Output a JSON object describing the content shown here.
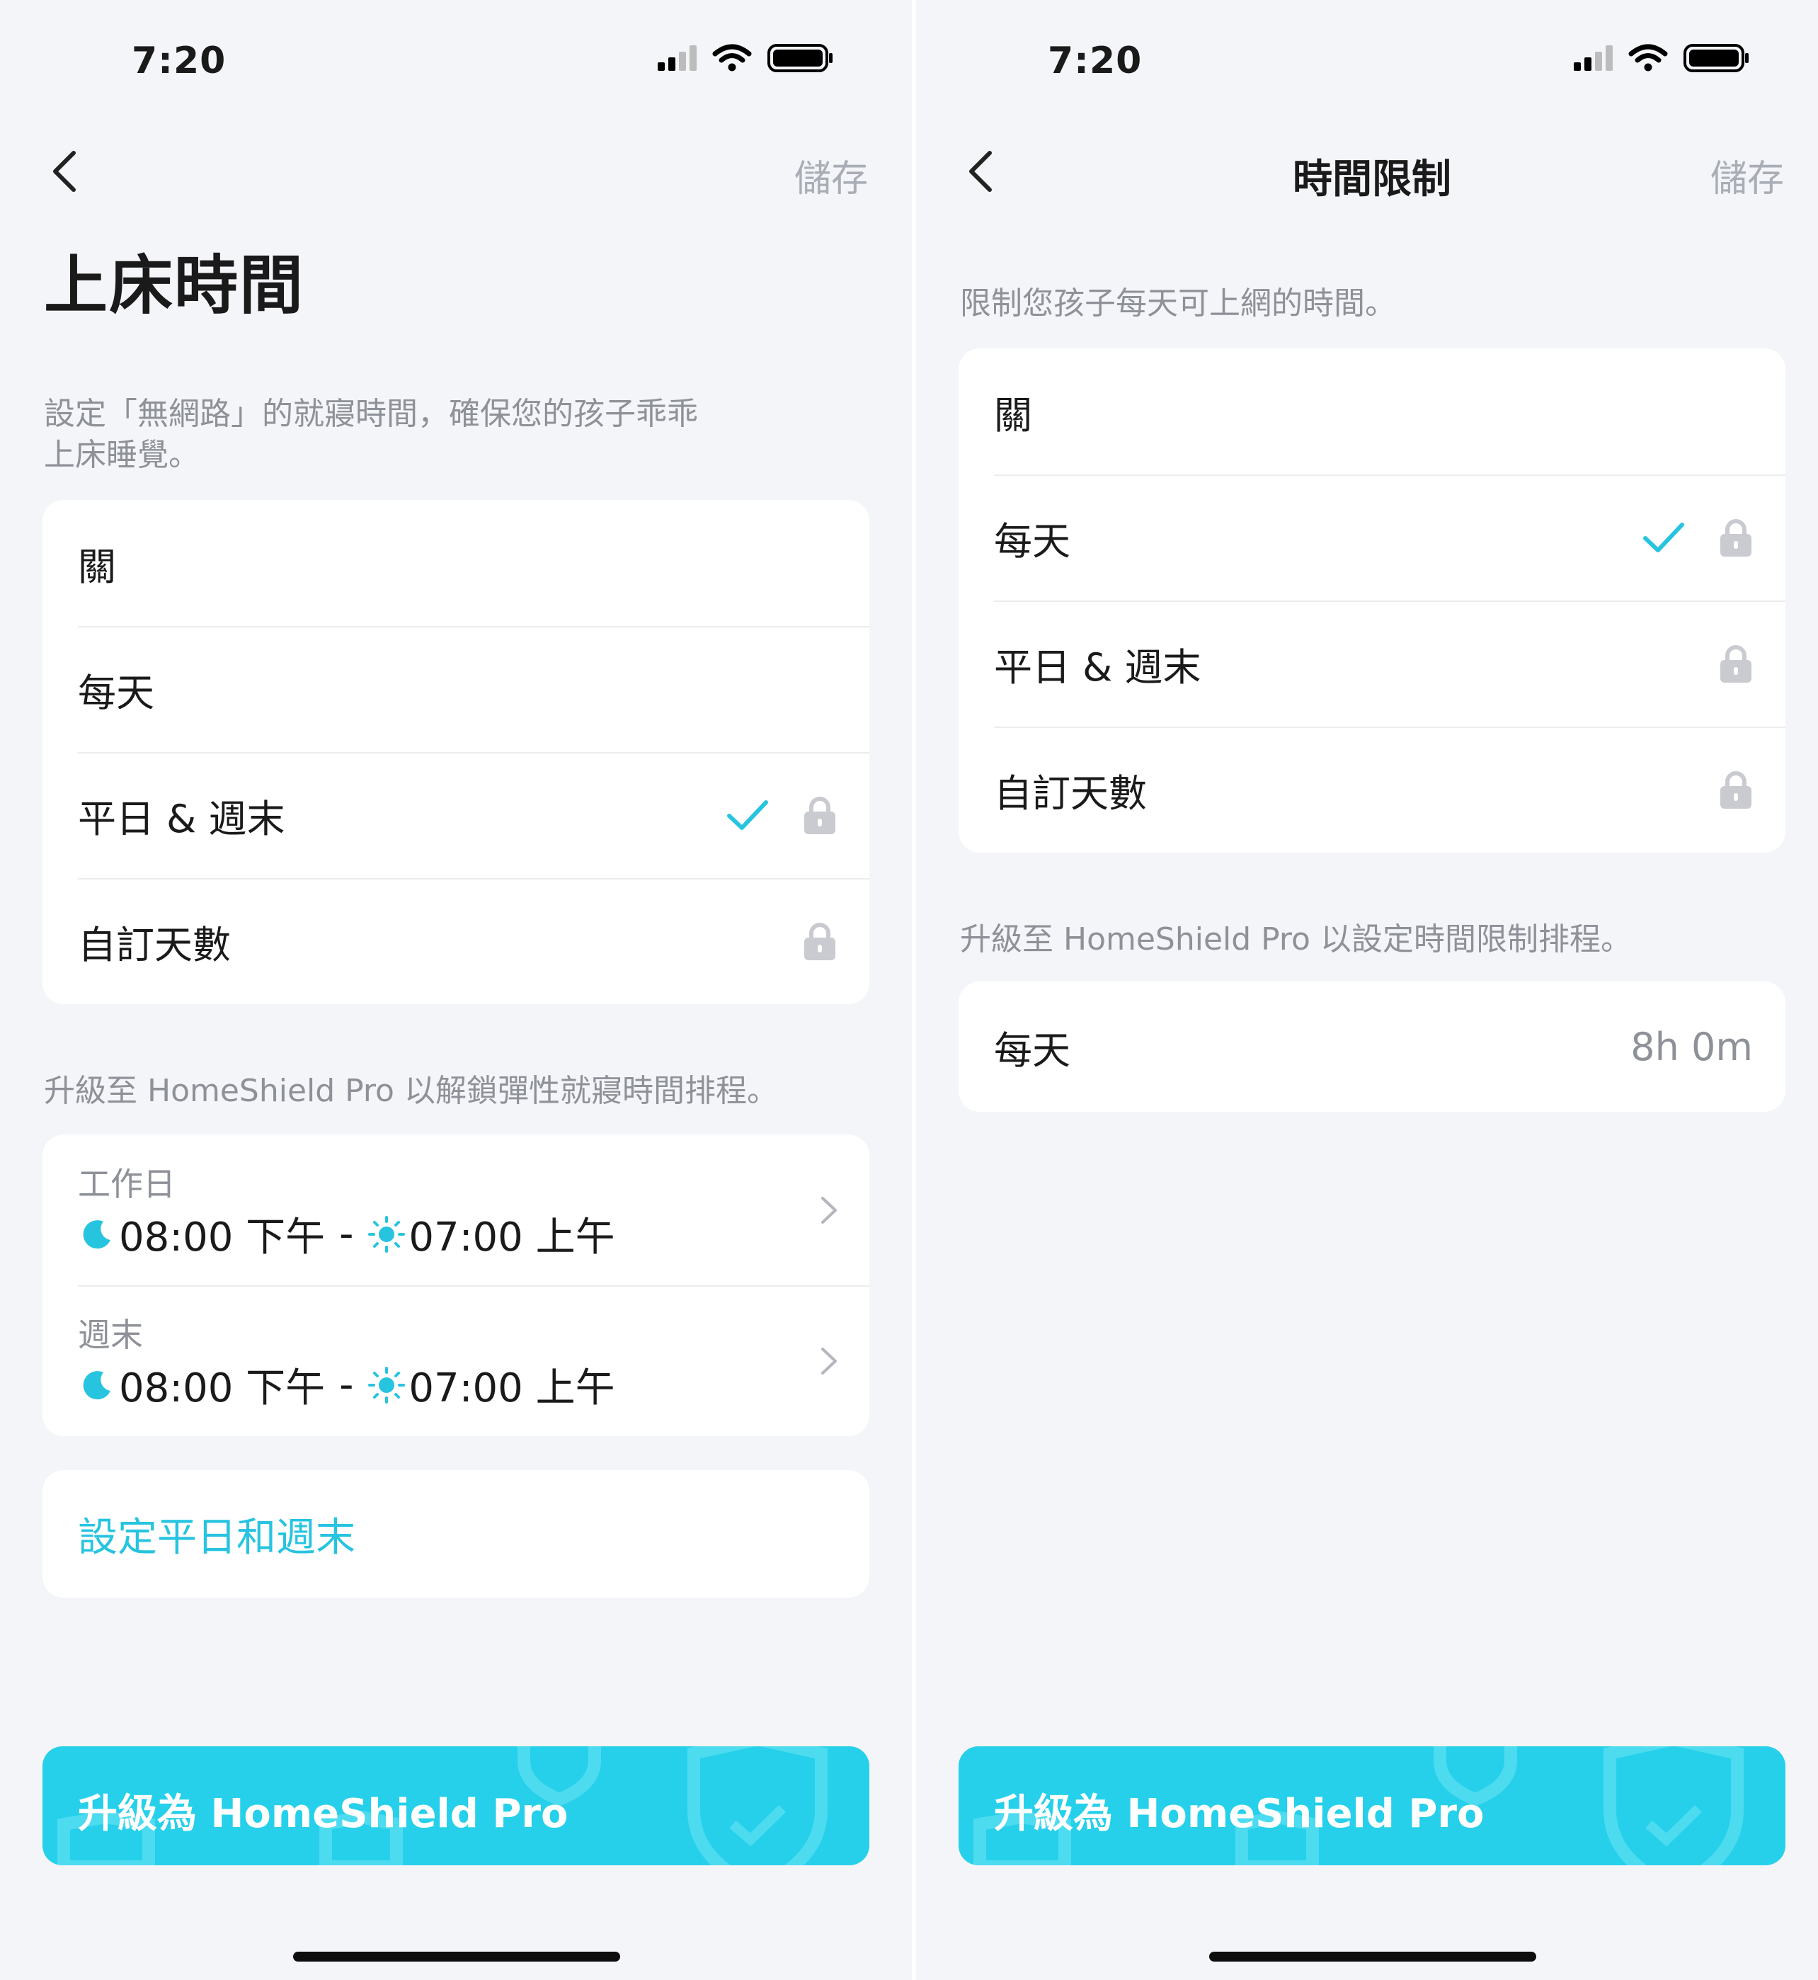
{
  "colors": {
    "accent": "#27c4e0",
    "background": "#f4f5f9",
    "card": "#ffffff",
    "muted": "#8e9198",
    "upgrade_bg": "#26d0ea"
  },
  "left": {
    "status_time": "7:20",
    "save_label": "儲存",
    "title": "上床時間",
    "description_line1": "設定「無網路」的就寢時間，確保您的孩子乖乖",
    "description_line2": "上床睡覺。",
    "options": [
      {
        "label": "關",
        "selected": false,
        "locked": false
      },
      {
        "label": "每天",
        "selected": false,
        "locked": false
      },
      {
        "label": "平日 & 週末",
        "selected": true,
        "locked": true
      },
      {
        "label": "自訂天數",
        "selected": false,
        "locked": true
      }
    ],
    "upgrade_note": "升級至 HomeShield Pro 以解鎖彈性就寢時間排程。",
    "schedules": [
      {
        "label": "工作日",
        "bedtime": "08:00 下午",
        "separator": "-",
        "wake": "07:00 上午",
        "bedtime_icon": "moon-icon",
        "wake_icon": "sun-icon"
      },
      {
        "label": "週末",
        "bedtime": "08:00 下午",
        "separator": "-",
        "wake": "07:00 上午",
        "bedtime_icon": "moon-icon",
        "wake_icon": "sun-icon"
      }
    ],
    "set_link": "設定平日和週末",
    "upgrade_button": "升級為 HomeShield Pro"
  },
  "right": {
    "status_time": "7:20",
    "nav_title": "時間限制",
    "save_label": "儲存",
    "description": "限制您孩子每天可上網的時間。",
    "options": [
      {
        "label": "關",
        "selected": false,
        "locked": false
      },
      {
        "label": "每天",
        "selected": true,
        "locked": true
      },
      {
        "label": "平日 & 週末",
        "selected": false,
        "locked": true
      },
      {
        "label": "自訂天數",
        "selected": false,
        "locked": true
      }
    ],
    "upgrade_note": "升級至 HomeShield Pro 以設定時間限制排程。",
    "limit_row": {
      "label": "每天",
      "value": "8h 0m"
    },
    "upgrade_button": "升級為 HomeShield Pro"
  }
}
